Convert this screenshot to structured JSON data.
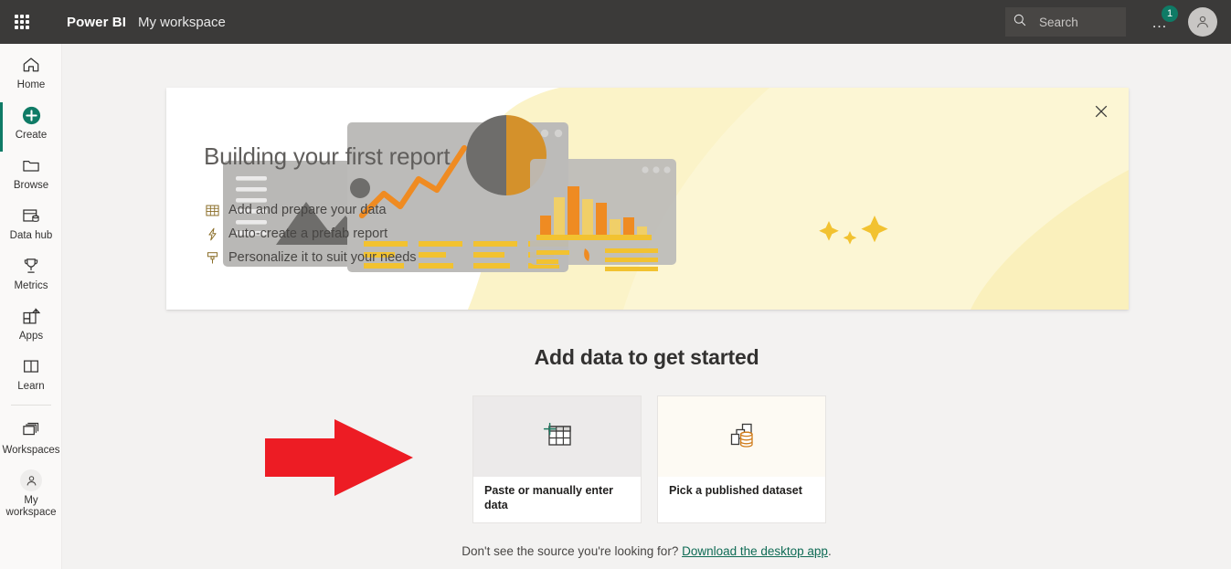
{
  "topbar": {
    "waffle_label": "app-launcher",
    "brand": "Power BI",
    "workspace": "My workspace",
    "search_placeholder": "Search",
    "search_value": "",
    "more_label": "…",
    "notification_count": "1",
    "account_label": "account"
  },
  "sidebar": {
    "items": [
      {
        "label": "Home",
        "icon": "home-icon",
        "active": false
      },
      {
        "label": "Create",
        "icon": "create-plus-icon",
        "active": true
      },
      {
        "label": "Browse",
        "icon": "folder-icon",
        "active": false
      },
      {
        "label": "Data hub",
        "icon": "data-hub-icon",
        "active": false
      },
      {
        "label": "Metrics",
        "icon": "trophy-icon",
        "active": false
      },
      {
        "label": "Apps",
        "icon": "apps-grid-icon",
        "active": false
      },
      {
        "label": "Learn",
        "icon": "book-icon",
        "active": false
      }
    ],
    "workspaces": {
      "label": "Workspaces",
      "icon": "workspaces-icon"
    },
    "my_workspace": {
      "label": "My workspace",
      "icon": "person-icon"
    }
  },
  "banner": {
    "title": "Building your first report",
    "bullets": [
      {
        "text": "Add and prepare your data",
        "icon": "table-grid-icon"
      },
      {
        "text": "Auto-create a prefab report",
        "icon": "lightning-bolt-icon"
      },
      {
        "text": "Personalize it to suit your needs",
        "icon": "paint-brush-icon"
      }
    ],
    "close_label": "close-banner",
    "illustration": "report-dashboard-illustration"
  },
  "main": {
    "add_data_title": "Add data to get started",
    "cards": [
      {
        "label": "Paste or manually enter data",
        "icon": "paste-table-icon",
        "state": "hovered"
      },
      {
        "label": "Pick a published dataset",
        "icon": "published-dataset-icon",
        "state": "tint"
      }
    ],
    "footnote_prefix": "Don't see the source you're looking for? ",
    "footnote_link": "Download the desktop app",
    "footnote_suffix": "."
  },
  "annotation": {
    "arrow": "red-right-arrow",
    "color": "#ed1c24"
  },
  "colors": {
    "accent_teal": "#0f7b66",
    "topbar": "#3b3a39",
    "page_bg": "#f3f2f1",
    "banner_yellow": "#fbf3c8",
    "link": "#0f6b55"
  }
}
